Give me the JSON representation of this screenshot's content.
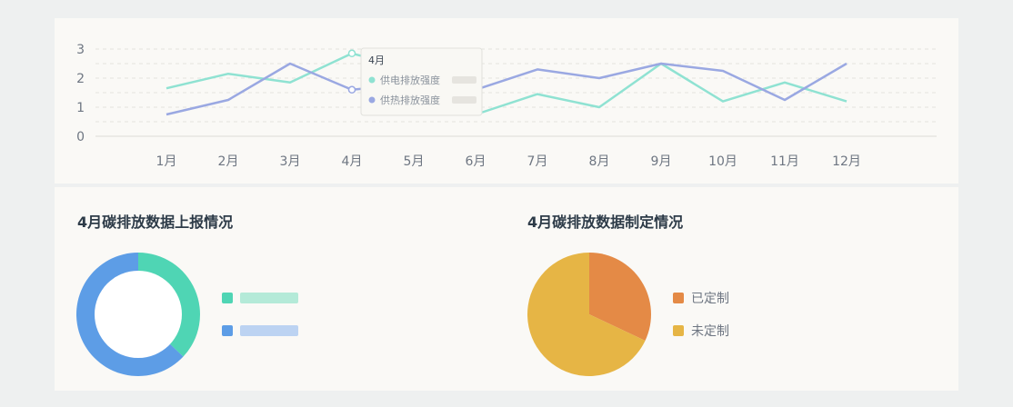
{
  "colors": {
    "page_bg": "#eef0f0",
    "card_bg": "#faf9f6",
    "power": "#8fe2d2",
    "heat": "#9aa8e2",
    "donut_green": "#4fd5b4",
    "donut_blue": "#5d9de6",
    "pie_orange": "#e48a46",
    "pie_yellow": "#e6b545"
  },
  "chart_data": [
    {
      "type": "line",
      "categories": [
        "1月",
        "2月",
        "3月",
        "4月",
        "5月",
        "6月",
        "7月",
        "8月",
        "9月",
        "10月",
        "11月",
        "12月"
      ],
      "ylim": [
        0,
        3
      ],
      "yticks": [
        "0",
        "1",
        "2",
        "3"
      ],
      "series": [
        {
          "name": "供电排放强度",
          "values": [
            1.65,
            2.15,
            1.85,
            2.85,
            2.3,
            0.75,
            1.45,
            1.0,
            2.5,
            1.2,
            1.85,
            1.2
          ]
        },
        {
          "name": "供热排放强度",
          "values": [
            0.75,
            1.25,
            2.5,
            1.6,
            1.8,
            1.6,
            2.3,
            2.0,
            2.5,
            2.25,
            1.25,
            2.5
          ]
        }
      ],
      "tooltip": {
        "title": "4月",
        "items": [
          {
            "name": "供电排放强度",
            "value": ""
          },
          {
            "name": "供热排放强度",
            "value": ""
          }
        ]
      }
    },
    {
      "type": "pie",
      "variant": "donut",
      "title": "4月碳排放数据上报情况",
      "slices": [
        {
          "label": "",
          "value": 37
        },
        {
          "label": "",
          "value": 63
        }
      ]
    },
    {
      "type": "pie",
      "title": "4月碳排放数据制定情况",
      "slices": [
        {
          "label": "已定制",
          "value": 32
        },
        {
          "label": "未定制",
          "value": 68
        }
      ]
    }
  ]
}
